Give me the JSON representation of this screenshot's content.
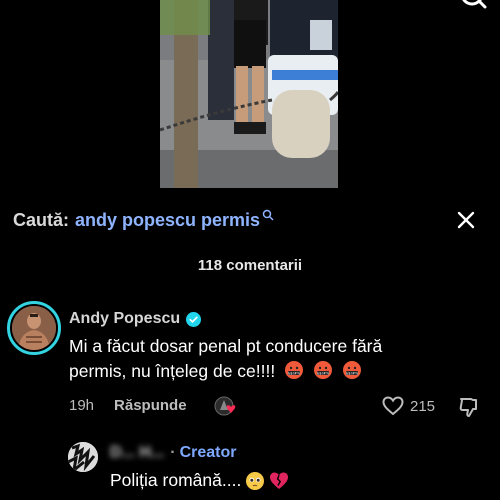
{
  "search": {
    "prefix": "Caută:",
    "query": "andy popescu permis",
    "inline_icon": "search-icon",
    "close_icon": "close-icon"
  },
  "top_icon": "search-icon",
  "video": {
    "icon": "video-thumbnail"
  },
  "comments": {
    "count_label": "118 comentarii"
  },
  "comment": {
    "author": "Andy Popescu",
    "verified_icon": "verified-badge-icon",
    "text": "Mi a făcut dosar penal pt conducere fără permis, nu înțeleg de ce!!!!",
    "emojis": [
      "face-with-symbols-on-mouth",
      "face-with-symbols-on-mouth",
      "face-with-symbols-on-mouth"
    ],
    "time": "19h",
    "reply_label": "Răspunde",
    "likes": "215",
    "accent_color": "#33d3e2"
  },
  "reply": {
    "author": "D... H...",
    "separator": "·",
    "creator_tag": "Creator",
    "text": "Poliția română....",
    "emojis": [
      "pleading-face",
      "broken-heart"
    ],
    "creator_color": "#7ea9ff"
  }
}
